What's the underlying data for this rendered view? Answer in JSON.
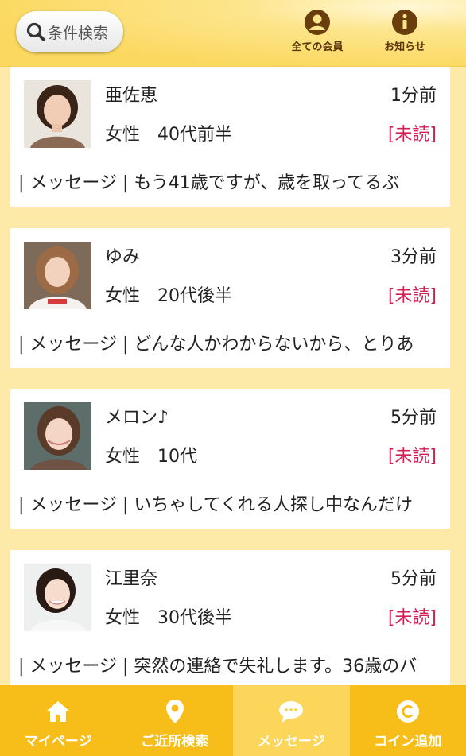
{
  "header": {
    "search_label": "条件検索",
    "all_members_label": "全ての会員",
    "notice_label": "お知らせ"
  },
  "messages": [
    {
      "name": "亜佐恵",
      "time": "1分前",
      "gender": "女性",
      "age": "40代前半",
      "status": "[未読]",
      "message": "| メッセージ | もう41歳ですが、歳を取ってるぶ"
    },
    {
      "name": "ゆみ",
      "time": "3分前",
      "gender": "女性",
      "age": "20代後半",
      "status": "[未読]",
      "message": "| メッセージ | どんな人かわからないから、とりあ"
    },
    {
      "name": "メロン♪",
      "time": "5分前",
      "gender": "女性",
      "age": "10代",
      "status": "[未読]",
      "message": "| メッセージ | いちゃしてくれる人探し中なんだけ"
    },
    {
      "name": "江里奈",
      "time": "5分前",
      "gender": "女性",
      "age": "30代後半",
      "status": "[未読]",
      "message": "| メッセージ | 突然の連絡で失礼します。36歳のバ"
    }
  ],
  "nav": {
    "mypage": "マイページ",
    "nearby": "ご近所検索",
    "message": "メッセージ",
    "coin": "コイン追加"
  },
  "colors": {
    "accent": "#f7be1a",
    "unread": "#d21f54",
    "background": "#fde9a8"
  }
}
